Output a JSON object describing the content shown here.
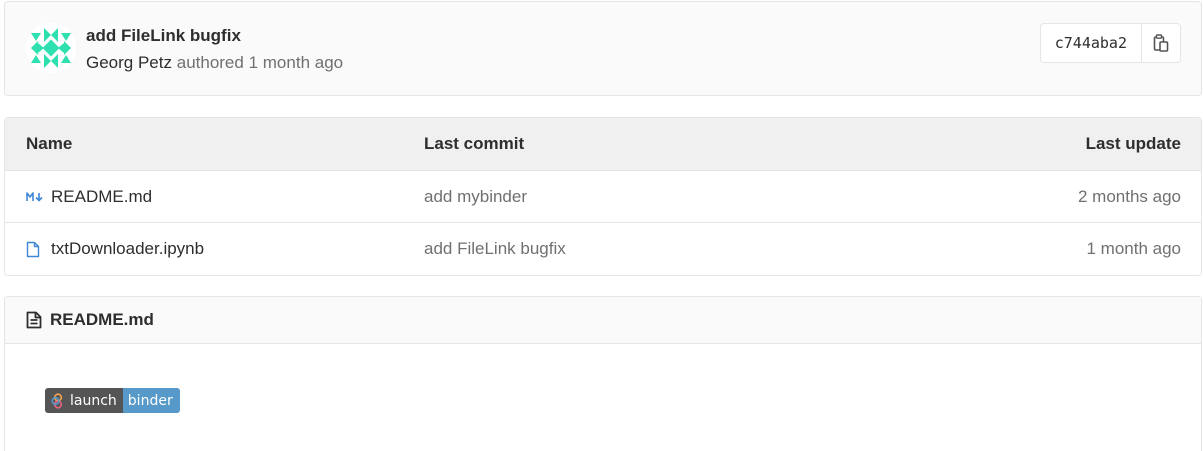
{
  "commit": {
    "title": "add FileLink bugfix",
    "author": "Georg Petz",
    "authored_label": "authored",
    "time_ago": "1 month ago",
    "sha": "c744aba2",
    "avatar_color": "#2ee0b0",
    "copy_icon": "clipboard-icon"
  },
  "tree": {
    "columns": {
      "name": "Name",
      "last_commit": "Last commit",
      "last_update": "Last update"
    },
    "rows": [
      {
        "name": "README.md",
        "icon": "markdown-icon",
        "last_commit": "add mybinder",
        "last_update": "2 months ago"
      },
      {
        "name": "txtDownloader.ipynb",
        "icon": "file-icon",
        "last_commit": "add FileLink bugfix",
        "last_update": "1 month ago"
      }
    ]
  },
  "readme": {
    "title": "README.md",
    "icon": "file-text-icon",
    "badge": {
      "left_text": "launch",
      "right_text": "binder",
      "left_color": "#555555",
      "right_color": "#579aca"
    }
  },
  "colors": {
    "link_icon_blue": "#3e86d6",
    "muted_text": "#707070",
    "border": "#e5e5e5"
  }
}
